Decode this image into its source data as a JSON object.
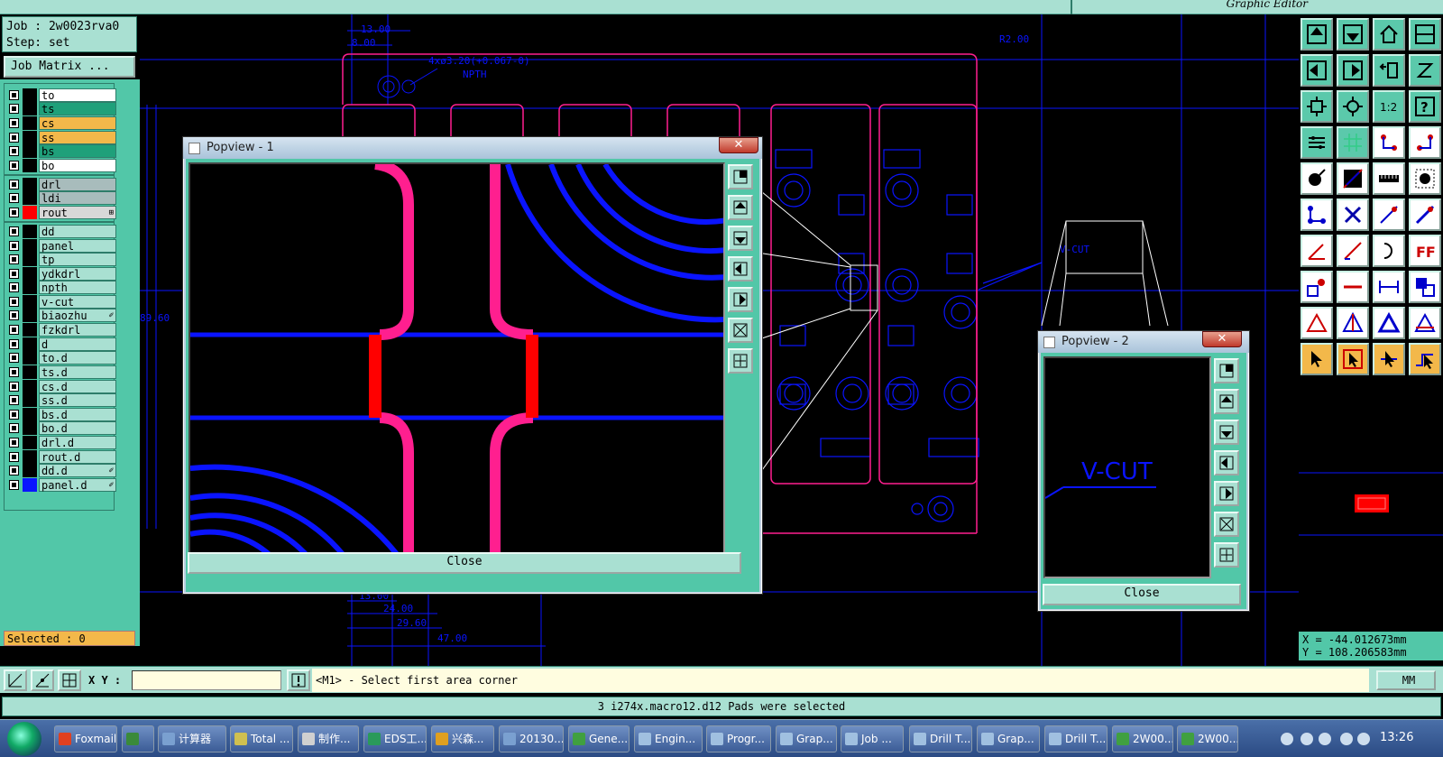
{
  "window": {
    "title": "Graphic Editor"
  },
  "job": {
    "job_line": "Job : 2w0023rva0",
    "step_line": "Step: set",
    "matrix_button": "Job Matrix ..."
  },
  "colors": {
    "panel_teal": "#52c7a8",
    "light_teal": "#a9e0d2",
    "magenta": "#ff1f8f",
    "blue": "#0a14ff",
    "red": "#ff0000",
    "orange": "#f3b84a"
  },
  "layers": [
    {
      "name": "to",
      "color": "#ffffff",
      "swatch": "#000000",
      "marker": ""
    },
    {
      "name": "ts",
      "color": "#1fa07a",
      "swatch": "#000000",
      "marker": ""
    },
    {
      "name": "cs",
      "color": "#f3b84a",
      "swatch": "#000000",
      "marker": ""
    },
    {
      "name": "ss",
      "color": "#f3b84a",
      "swatch": "#000000",
      "marker": ""
    },
    {
      "name": "bs",
      "color": "#1fa07a",
      "swatch": "#000000",
      "marker": ""
    },
    {
      "name": "bo",
      "color": "#ffffff",
      "swatch": "#000000",
      "marker": ""
    },
    {
      "name": "drl",
      "color": "#a8bcbc",
      "swatch": "#000000",
      "marker": ""
    },
    {
      "name": "ldi",
      "color": "#a8bcbc",
      "swatch": "#000000",
      "marker": ""
    },
    {
      "name": "rout",
      "color": "#d8d8d8",
      "swatch": "#ff0000",
      "marker": "⊞"
    },
    {
      "name": "dd",
      "color": "#a9e0d2",
      "swatch": "#000000",
      "marker": ""
    },
    {
      "name": "panel",
      "color": "#a9e0d2",
      "swatch": "#000000",
      "marker": ""
    },
    {
      "name": "tp",
      "color": "#a9e0d2",
      "swatch": "#000000",
      "marker": ""
    },
    {
      "name": "ydkdrl",
      "color": "#a9e0d2",
      "swatch": "#000000",
      "marker": ""
    },
    {
      "name": "npth",
      "color": "#a9e0d2",
      "swatch": "#000000",
      "marker": ""
    },
    {
      "name": "v-cut",
      "color": "#a9e0d2",
      "swatch": "#000000",
      "marker": ""
    },
    {
      "name": "biaozhu",
      "color": "#a9e0d2",
      "swatch": "#000000",
      "marker": "✐"
    },
    {
      "name": "fzkdrl",
      "color": "#a9e0d2",
      "swatch": "#000000",
      "marker": ""
    },
    {
      "name": "d",
      "color": "#a9e0d2",
      "swatch": "#000000",
      "marker": ""
    },
    {
      "name": "to.d",
      "color": "#a9e0d2",
      "swatch": "#000000",
      "marker": ""
    },
    {
      "name": "ts.d",
      "color": "#a9e0d2",
      "swatch": "#000000",
      "marker": ""
    },
    {
      "name": "cs.d",
      "color": "#a9e0d2",
      "swatch": "#000000",
      "marker": ""
    },
    {
      "name": "ss.d",
      "color": "#a9e0d2",
      "swatch": "#000000",
      "marker": ""
    },
    {
      "name": "bs.d",
      "color": "#a9e0d2",
      "swatch": "#000000",
      "marker": ""
    },
    {
      "name": "bo.d",
      "color": "#a9e0d2",
      "swatch": "#000000",
      "marker": ""
    },
    {
      "name": "drl.d",
      "color": "#a9e0d2",
      "swatch": "#000000",
      "marker": ""
    },
    {
      "name": "rout.d",
      "color": "#a9e0d2",
      "swatch": "#000000",
      "marker": ""
    },
    {
      "name": "dd.d",
      "color": "#a9e0d2",
      "swatch": "#000000",
      "marker": "✐"
    },
    {
      "name": "panel.d",
      "color": "#a9e0d2",
      "swatch": "#0a14ff",
      "marker": "✐"
    }
  ],
  "selected_text": "Selected : 0",
  "canvas_labels": {
    "d1": "13.00",
    "d2": "8.00",
    "hole": "4xø3.20(+0.067-0)",
    "npth": "NPTH",
    "radius": "R2.00",
    "height": "89.60",
    "vcut": "V-CUT",
    "b1": "13.00",
    "b2": "24.00",
    "b3": "29.60",
    "b4": "47.00"
  },
  "popview1": {
    "title": "Popview - 1",
    "close_label": "Close",
    "close_x": "✕"
  },
  "popview2": {
    "title": "Popview - 2",
    "close_label": "Close",
    "close_x": "✕",
    "text": "V-CUT"
  },
  "coords": {
    "x_line": "X = -44.012673mm",
    "y_line": "Y = 108.206583mm"
  },
  "command": {
    "xy_label": "X Y :",
    "xy_value": "",
    "prompt": "<M1> - Select first area corner",
    "units": "MM"
  },
  "status": "3 i274x.macro12.d12 Pads were selected",
  "taskbar": {
    "items": [
      {
        "label": "Foxmail",
        "icon": "#e04020"
      },
      {
        "label": "",
        "icon": "#3a8a3a"
      },
      {
        "label": "计算器",
        "icon": "#7aa0d0"
      },
      {
        "label": "Total ...",
        "icon": "#d0c050"
      },
      {
        "label": "制作...",
        "icon": "#d0d0d0"
      },
      {
        "label": "EDS工...",
        "icon": "#2a9a5a"
      },
      {
        "label": "兴森...",
        "icon": "#e0a020"
      },
      {
        "label": "20130...",
        "icon": "#7aa0d0"
      },
      {
        "label": "Gene...",
        "icon": "#40a040"
      },
      {
        "label": "Engin...",
        "icon": "#a0c0e0"
      },
      {
        "label": "Progr...",
        "icon": "#a0c0e0"
      },
      {
        "label": "Grap...",
        "icon": "#a0c0e0"
      },
      {
        "label": "Job ...",
        "icon": "#a0c0e0"
      },
      {
        "label": "Drill T...",
        "icon": "#a0c0e0"
      },
      {
        "label": "Grap...",
        "icon": "#a0c0e0"
      },
      {
        "label": "Drill T...",
        "icon": "#a0c0e0"
      },
      {
        "label": "2W00...",
        "icon": "#40a040"
      },
      {
        "label": "2W00...",
        "icon": "#40a040"
      }
    ],
    "clock": "13:26"
  }
}
